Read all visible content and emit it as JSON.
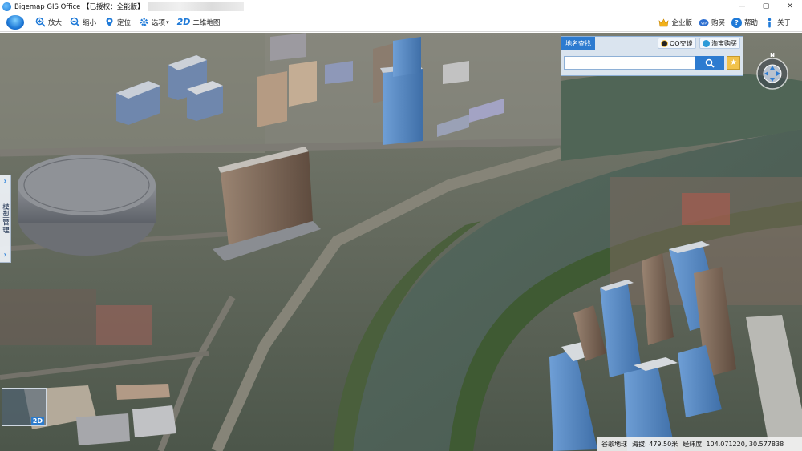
{
  "window": {
    "title": "Bigemap GIS Office 【已授权：全能版】",
    "controls": {
      "minimize": "—",
      "maximize": "▢",
      "close": "✕"
    }
  },
  "toolbar": {
    "items": [
      {
        "label": "放大",
        "icon": "zoom-in-icon"
      },
      {
        "label": "缩小",
        "icon": "zoom-out-icon"
      },
      {
        "label": "定位",
        "icon": "location-pin-icon"
      },
      {
        "label": "选项",
        "icon": "gear-icon"
      },
      {
        "label": "二维地图",
        "icon": "2d-icon",
        "icon_text": "2D"
      }
    ],
    "right": [
      {
        "label": "企业版",
        "icon": "enterprise-badge-icon"
      },
      {
        "label": "购买",
        "icon": "purchase-icon"
      },
      {
        "label": "帮助",
        "icon": "help-icon",
        "icon_text": "?"
      },
      {
        "label": "关于",
        "icon": "info-icon"
      }
    ]
  },
  "side_panel": {
    "label": "模型管理"
  },
  "search": {
    "tab_label": "地名查找",
    "qq_label": "QQ交谈",
    "taobao_label": "淘宝购买",
    "placeholder": ""
  },
  "thumbnail": {
    "label": "2D"
  },
  "status": {
    "source": "谷歌地球",
    "altitude": "海拔: 479.50米",
    "coords": "经纬度:  104.071220, 30.577838"
  },
  "colors": {
    "accent": "#2d7bd0",
    "river": "#4d5f55",
    "vegetation": "#3f5a33"
  }
}
